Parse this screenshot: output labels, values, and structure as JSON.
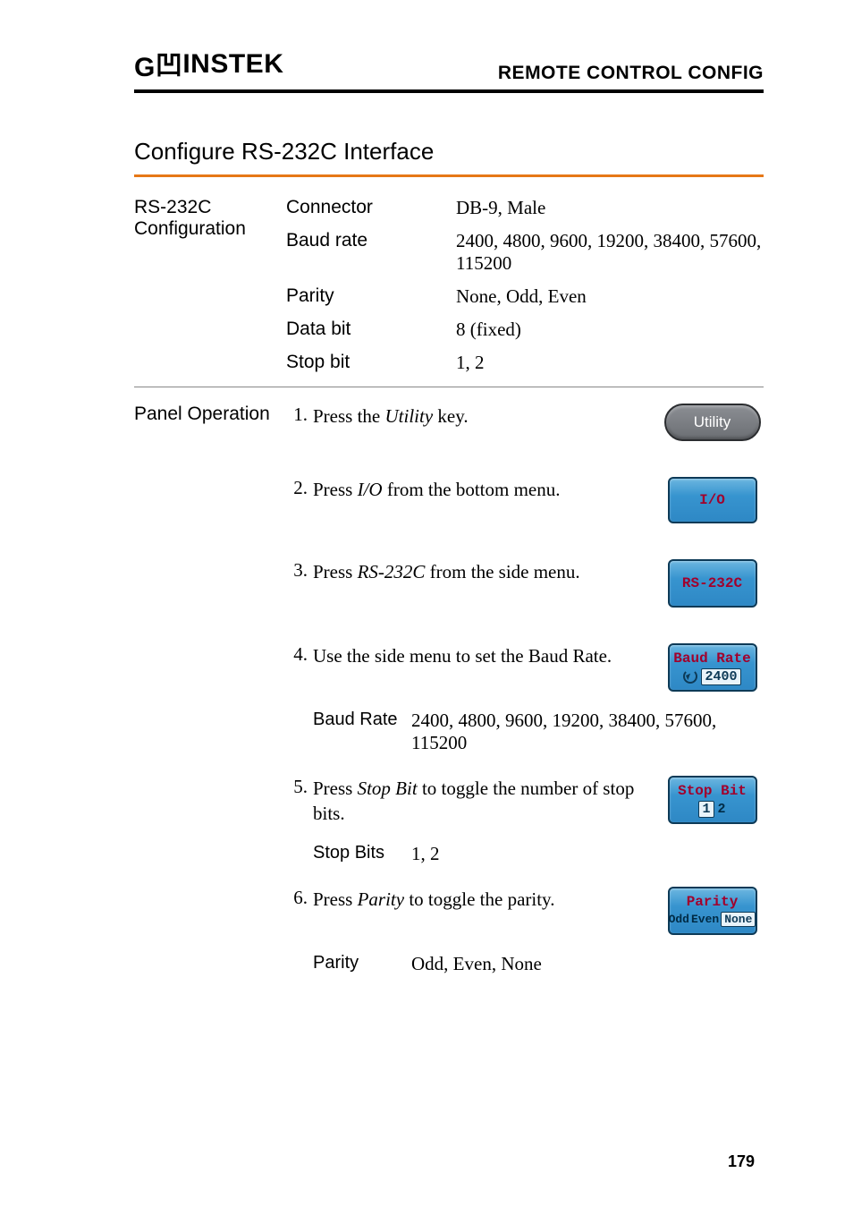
{
  "header": {
    "logo_prefix": "G",
    "logo_suffix": "INSTEK",
    "title": "REMOTE CONTROL CONFIG"
  },
  "section_title": "Configure RS-232C Interface",
  "config": {
    "heading": "RS-232C Configuration",
    "rows": [
      {
        "label": "Connector",
        "value": "DB-9, Male"
      },
      {
        "label": "Baud rate",
        "value": "2400, 4800, 9600, 19200, 38400, 57600, 115200"
      },
      {
        "label": "Parity",
        "value": "None, Odd, Even"
      },
      {
        "label": "Data bit",
        "value": "8 (fixed)"
      },
      {
        "label": "Stop bit",
        "value": "1, 2"
      }
    ]
  },
  "panel_heading": "Panel Operation",
  "steps": {
    "s1": {
      "num": "1.",
      "pre": "Press the ",
      "ital": "Utility",
      "post": " key."
    },
    "s2": {
      "num": "2.",
      "pre": "Press ",
      "ital": "I/O",
      "post": " from the bottom menu."
    },
    "s3": {
      "num": "3.",
      "pre": "Press ",
      "ital": "RS-232C",
      "post": " from the side menu."
    },
    "s4": {
      "num": "4.",
      "text": "Use the side menu to set the Baud Rate."
    },
    "s4_sub": {
      "label": "Baud Rate",
      "value": "2400, 4800, 9600, 19200, 38400, 57600, 115200"
    },
    "s5": {
      "num": "5.",
      "pre": "Press ",
      "ital": "Stop Bit",
      "post": " to toggle the number of stop bits."
    },
    "s5_sub": {
      "label": "Stop Bits",
      "value": "1, 2"
    },
    "s6": {
      "num": "6.",
      "pre": "Press ",
      "ital": "Parity",
      "post": " to toggle the parity."
    },
    "s6_sub": {
      "label": "Parity",
      "value": "Odd, Even, None"
    }
  },
  "buttons": {
    "utility": "Utility",
    "io": "I/O",
    "rs232c": "RS-232C",
    "baud": {
      "title": "Baud Rate",
      "value": "2400"
    },
    "stopbit": {
      "title": "Stop Bit",
      "opt1": "1",
      "opt2": "2"
    },
    "parity": {
      "title": "Parity",
      "opt1": "Odd",
      "opt2": "Even",
      "opt3": "None"
    }
  },
  "page_number": "179"
}
